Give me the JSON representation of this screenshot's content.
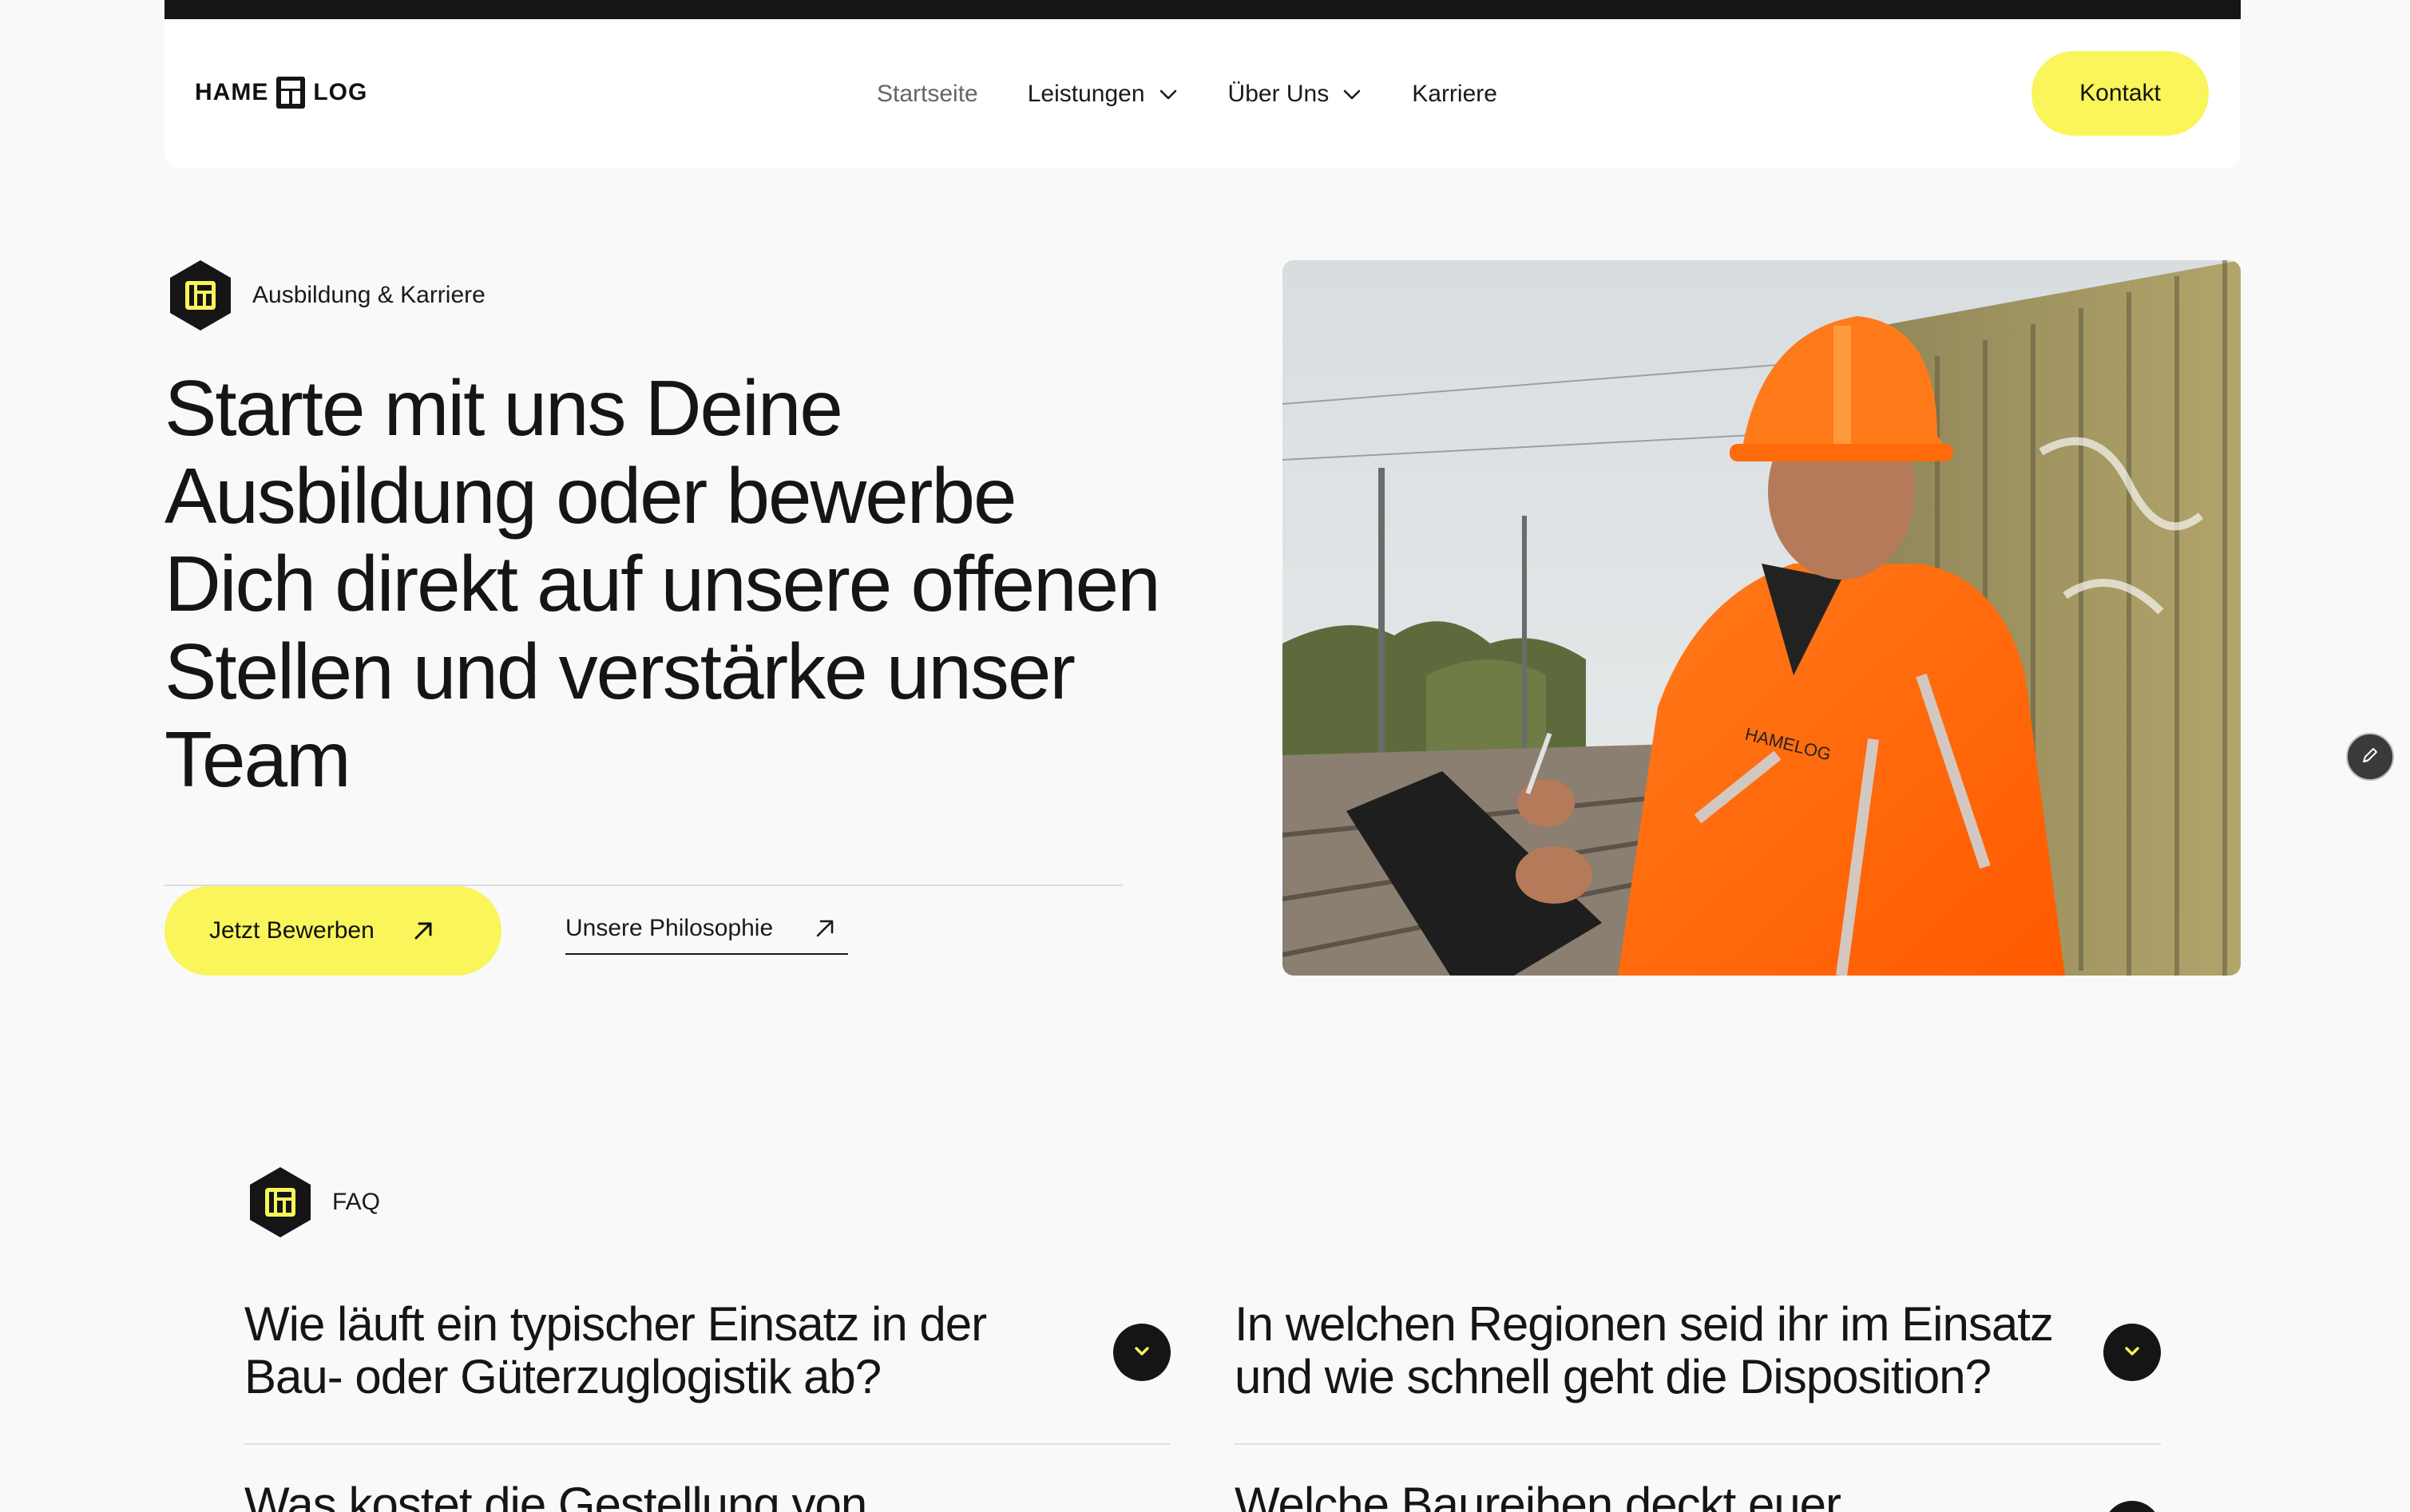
{
  "brand": {
    "logo_left": "HAME",
    "logo_right": "LOG",
    "accent_color": "#f9f55a",
    "dark_color": "#151515"
  },
  "nav": {
    "items": [
      {
        "label": "Startseite",
        "has_dropdown": false,
        "active": true
      },
      {
        "label": "Leistungen",
        "has_dropdown": true,
        "active": false
      },
      {
        "label": "Über Uns",
        "has_dropdown": true,
        "active": false
      },
      {
        "label": "Karriere",
        "has_dropdown": false,
        "active": false
      }
    ],
    "contact_label": "Kontakt"
  },
  "hero": {
    "badge_label": "Ausbildung & Karriere",
    "title": "Starte mit uns Deine Ausbildung oder bewerbe Dich direkt auf unsere offenen Stellen und verstärke unser Team",
    "apply_label": "Jetzt Bewerben",
    "philosophy_label": "Unsere Philosophie",
    "photo_icon": "worker-photo",
    "photo_jacket_text": "HAMELOG"
  },
  "faq": {
    "badge_label": "FAQ",
    "items": [
      {
        "question": " Wie läuft ein typischer Einsatz in der Bau- oder Güterzuglogistik ab?"
      },
      {
        "question": "In welchen Regionen seid ihr im Einsatz und wie schnell geht die Disposition?"
      },
      {
        "question": "Was kostet die Gestellung von"
      },
      {
        "question": "Welche Baureihen deckt euer"
      }
    ]
  },
  "icons": {
    "edit": "pencil-icon",
    "chevron": "chevron-down-icon",
    "arrow": "arrow-up-right-icon"
  }
}
